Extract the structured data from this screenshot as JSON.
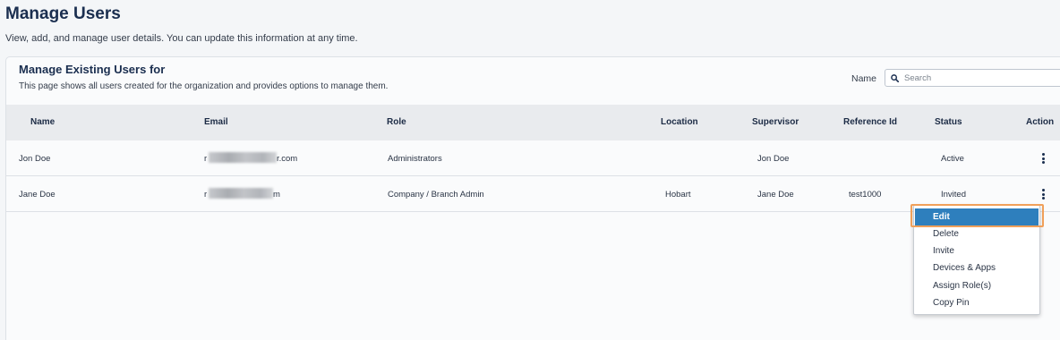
{
  "page": {
    "title": "Manage Users",
    "subtitle": "View, add, and manage user details. You can update this information at any time."
  },
  "card": {
    "title": "Manage Existing Users for",
    "description": "This page shows all users created for the organization and provides options to manage them.",
    "filter_label": "Name",
    "search_placeholder": "Search",
    "search_value": ""
  },
  "table": {
    "columns": [
      "Name",
      "Email",
      "Role",
      "Location",
      "Supervisor",
      "Reference Id",
      "Status",
      "Action"
    ],
    "rows": [
      {
        "name": "Jon Doe",
        "email_prefix": "r",
        "email_suffix": "r.com",
        "role": "Administrators",
        "location": "",
        "supervisor": "Jon Doe",
        "reference_id": "",
        "status": "Active"
      },
      {
        "name": "Jane Doe",
        "email_prefix": "r",
        "email_suffix": "m",
        "role": "Company / Branch Admin",
        "location": "Hobart",
        "supervisor": "Jane Doe",
        "reference_id": "test1000",
        "status": "Invited"
      }
    ]
  },
  "action_menu": {
    "items": [
      "Edit",
      "Delete",
      "Invite",
      "Devices & Apps",
      "Assign Role(s)",
      "Copy Pin"
    ],
    "active_item": "Edit",
    "highlight_color": "#f0a05a",
    "active_color": "#2e7fbd"
  },
  "icons": {
    "search": "search-icon",
    "action": "kebab-menu-icon"
  }
}
